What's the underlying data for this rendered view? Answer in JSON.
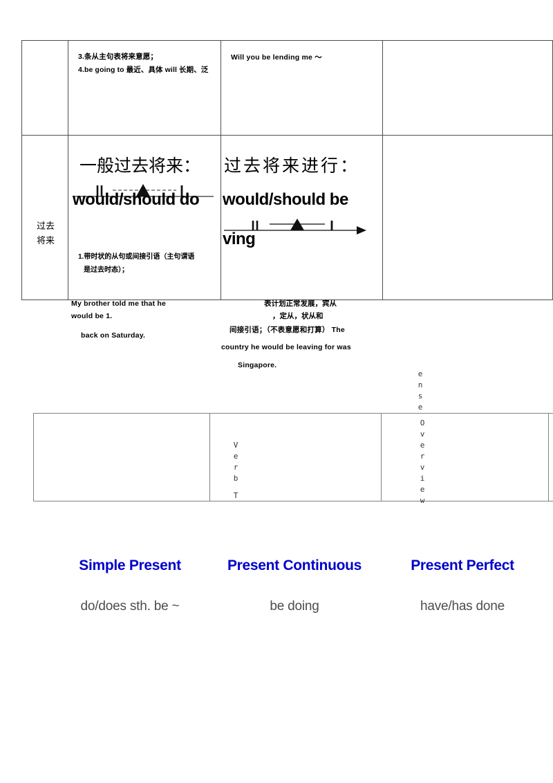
{
  "document": {
    "colors": {
      "tense_title_blue": "#0000CC",
      "tense_form_grey": "#4D4D4D",
      "table_border_dark": "#4D4D4D",
      "table_border_grey": "#808080"
    }
  },
  "main_table": {
    "row1": {
      "col_a": "",
      "col_b_lines": [
        "3.条从主句表将来意愿；",
        "4.be going to 最近、具体 will 长期、泛"
      ],
      "col_c": "Will you be lending me ～",
      "col_d": ""
    },
    "row2": {
      "col_a_label_lines": [
        "过去",
        "将来"
      ],
      "col_b": {
        "heading_cjk": "一般过去将来：",
        "heading_form": "would/should do",
        "note_lines": [
          "1.带时状的从句或间接引语（主句谓语",
          "是过去时态）；"
        ]
      },
      "col_c": {
        "heading_cjk": "过去将来进行：",
        "heading_form_line1": "would/should      be",
        "heading_form_line2": "ving"
      },
      "col_d": ""
    }
  },
  "below_table": {
    "left_example_lines": [
      "My brother told me that he",
      "would be   1.",
      "back on Saturday."
    ],
    "right_cjk_lines": [
      "表计划正常发展，宾从",
      "，定从，状从和"
    ],
    "right_mixed_lines": [
      "间接引语；（不表意愿和打算）    The",
      "country he would be leaving for was",
      "Singapore."
    ]
  },
  "vertical_text": {
    "ense": [
      "e",
      "n",
      "s",
      "e"
    ],
    "overview": [
      "O",
      "v",
      "e",
      "r",
      "v",
      "i",
      "e",
      "w"
    ],
    "verb": [
      "V",
      "e",
      "r",
      "b"
    ],
    "t": [
      "T"
    ]
  },
  "bottom_table": {
    "cells": [
      "",
      "",
      "",
      ""
    ]
  },
  "tenses": [
    {
      "title": "Simple Present",
      "form": "do/does sth. be ~"
    },
    {
      "title": "Present Continuous",
      "form": "be doing"
    },
    {
      "title": "Present Perfect",
      "form": "have/has done"
    }
  ]
}
